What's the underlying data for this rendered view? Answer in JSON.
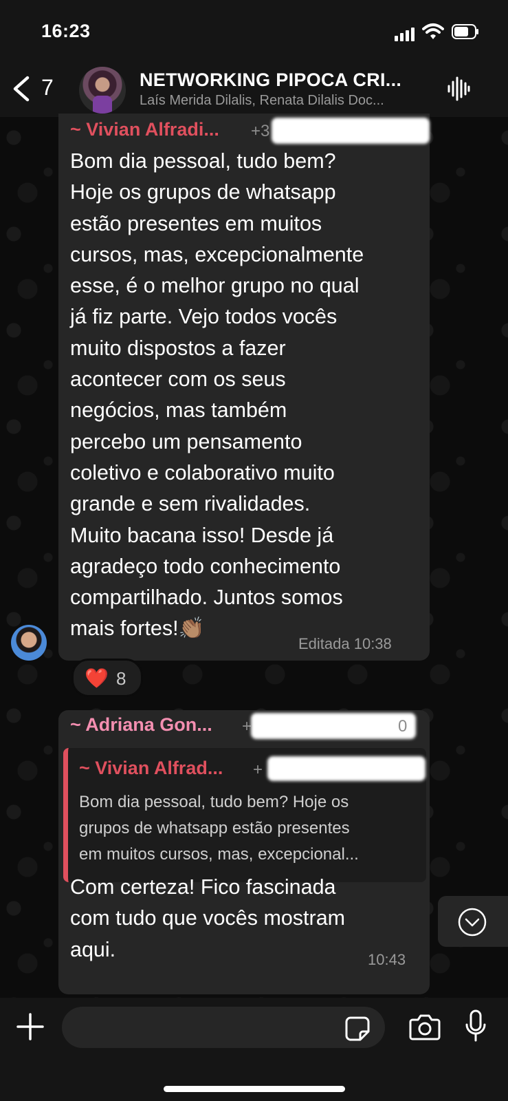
{
  "status_bar": {
    "time": "16:23"
  },
  "header": {
    "back_count": "7",
    "title": "NETWORKING PIPOCA CRI...",
    "subtitle": "Laís Merida Dilalis, Renata Dilalis Doc..."
  },
  "messages": [
    {
      "sender": "~ Vivian Alfradi...",
      "sender_color": "#e0505e",
      "phone_partial": "+3",
      "lines": [
        "Bom dia pessoal, tudo bem?",
        "Hoje os grupos de whatsapp",
        "estão presentes em muitos",
        "cursos, mas, excepcionalmente",
        "esse, é o melhor grupo no qual",
        "já fiz parte. Vejo todos vocês",
        "muito dispostos a fazer",
        "acontecer com os seus",
        "negócios, mas também",
        "percebo um pensamento",
        "coletivo e colaborativo muito",
        "grande e sem rivalidades.",
        "Muito bacana isso! Desde já",
        "agradeço todo conhecimento",
        "compartilhado. Juntos somos",
        "mais fortes!"
      ],
      "emoji": "👏🏽",
      "meta": "Editada 10:38",
      "reaction": {
        "emoji": "❤️",
        "count": "8"
      }
    },
    {
      "sender": "~ Adriana Gon...",
      "sender_color": "#f48fb1",
      "phone_partial": "+",
      "phone_tail": "0",
      "quote": {
        "sender": "~ Vivian Alfrad...",
        "phone_partial": "+",
        "lines": [
          "Bom dia pessoal, tudo bem? Hoje os",
          "grupos de whatsapp estão presentes",
          "em muitos cursos, mas, excepcional..."
        ]
      },
      "lines": [
        "Com certeza! Fico fascinada",
        "com tudo que vocês mostram",
        "aqui."
      ],
      "time": "10:43"
    }
  ],
  "icons": {
    "back": "chevron-left-icon",
    "voice": "waveform-icon",
    "scroll": "chevron-down-circle-icon",
    "plus": "plus-icon",
    "sticker": "sticker-icon",
    "camera": "camera-icon",
    "mic": "microphone-icon"
  }
}
